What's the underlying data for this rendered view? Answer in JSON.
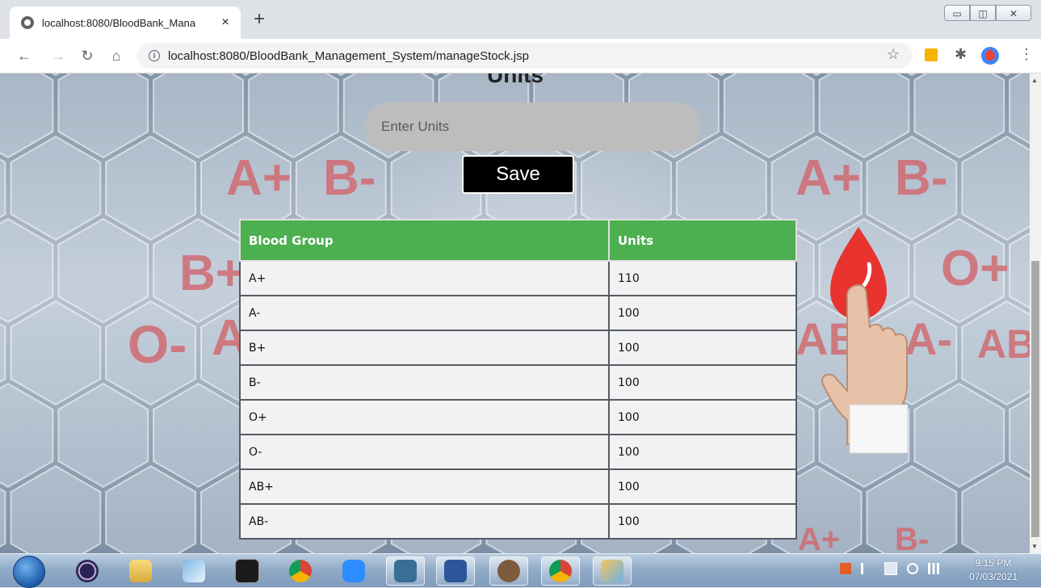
{
  "browser": {
    "tab_title": "localhost:8080/BloodBank_Mana",
    "tab_close": "×",
    "new_tab": "+",
    "url": "localhost:8080/BloodBank_Management_System/manageStock.jsp",
    "window_controls": [
      "▭",
      "◫",
      "✕"
    ]
  },
  "page": {
    "heading": "Units",
    "units_input": {
      "placeholder": "Enter Units",
      "value": ""
    },
    "save_label": "Save",
    "table": {
      "headers": [
        "Blood Group",
        "Units"
      ],
      "rows": [
        [
          "A+",
          "110"
        ],
        [
          "A-",
          "100"
        ],
        [
          "B+",
          "100"
        ],
        [
          "B-",
          "100"
        ],
        [
          "O+",
          "100"
        ],
        [
          "O-",
          "100"
        ],
        [
          "AB+",
          "100"
        ],
        [
          "AB-",
          "100"
        ]
      ]
    },
    "background_labels": [
      "A+",
      "B-",
      "B+",
      "O-",
      "A",
      "A+",
      "B-",
      "O+",
      "AB",
      "A-",
      "AB",
      "A+",
      "B-"
    ]
  },
  "taskbar": {
    "apps": [
      "start-orb",
      "eclipse",
      "file-explorer",
      "notepad",
      "terminal",
      "chrome",
      "zoom",
      "mysql-workbench",
      "word",
      "tomcat",
      "chrome",
      "paint"
    ],
    "clock_time": "9:15 PM",
    "clock_date": "07/03/2021"
  },
  "colors": {
    "table_header": "#4caf50",
    "save_button": "#000000",
    "input_bg": "#bdbdbd",
    "hex_labels": "#d06b72"
  }
}
